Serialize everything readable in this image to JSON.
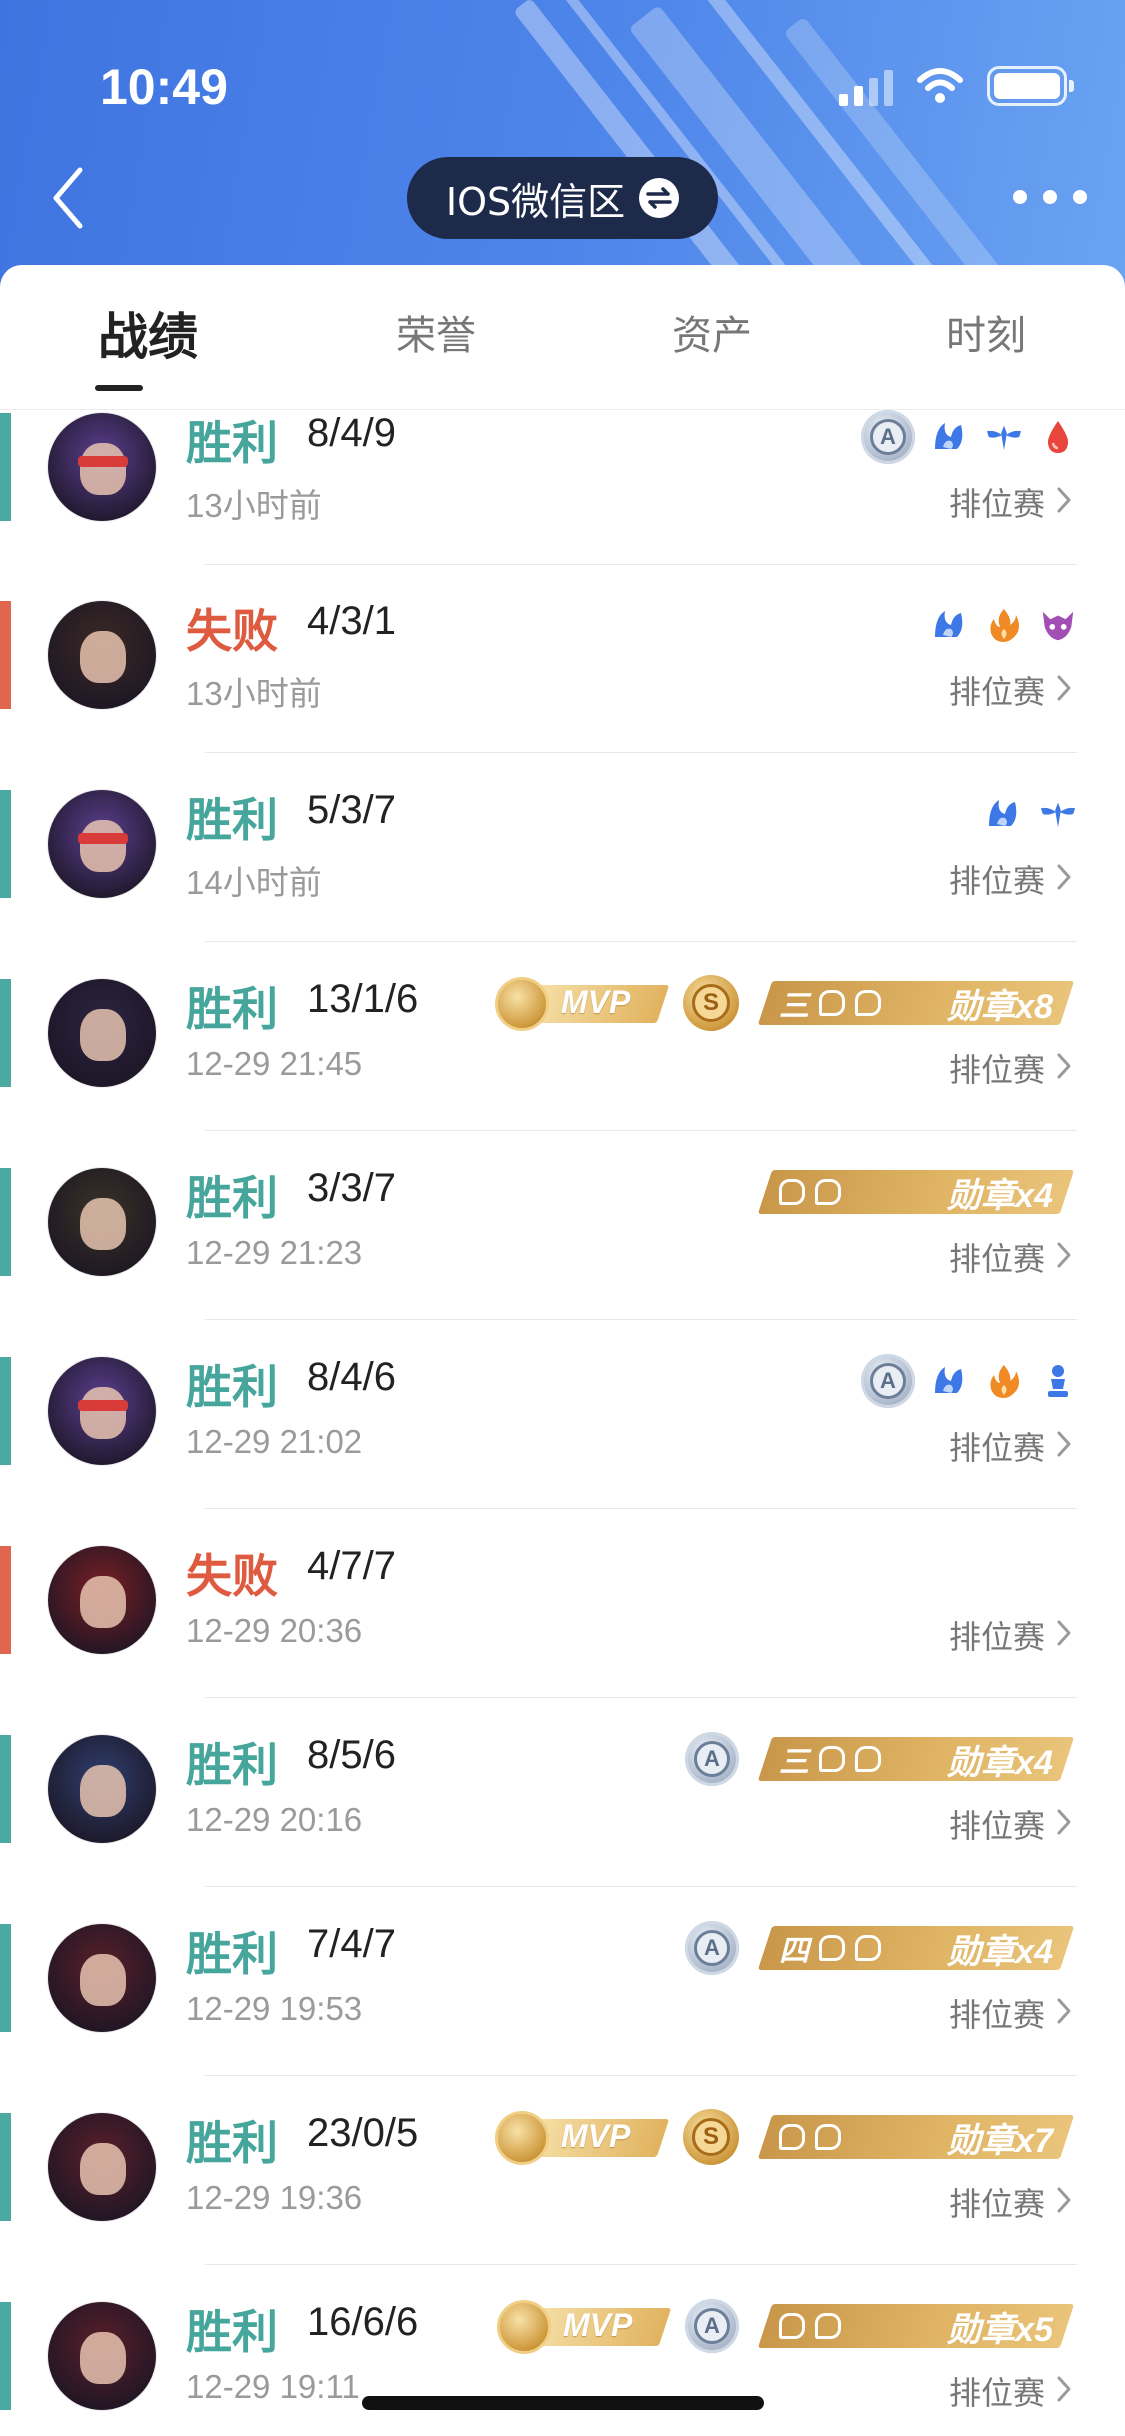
{
  "status_bar": {
    "time": "10:49"
  },
  "header": {
    "server_label": "IOS微信区"
  },
  "tabs": [
    {
      "label": "战绩",
      "active": true
    },
    {
      "label": "荣誉",
      "active": false
    },
    {
      "label": "资产",
      "active": false
    },
    {
      "label": "时刻",
      "active": false
    }
  ],
  "matches": [
    {
      "result": "胜利",
      "outcome": "win",
      "kda": "8/4/9",
      "time": "13小时前",
      "mode": "排位赛",
      "hero_color": "#5b3f8f",
      "badges": [
        "a",
        "icon-blue-flame",
        "icon-blue-wings",
        "icon-red-drop"
      ]
    },
    {
      "result": "失败",
      "outcome": "loss",
      "kda": "4/3/1",
      "time": "13小时前",
      "mode": "排位赛",
      "hero_color": "#3b2a25",
      "badges": [
        "icon-blue-flame",
        "icon-orange-fire",
        "icon-purple-demon"
      ]
    },
    {
      "result": "胜利",
      "outcome": "win",
      "kda": "5/3/7",
      "time": "14小时前",
      "mode": "排位赛",
      "hero_color": "#5b3f8f",
      "badges": [
        "icon-blue-flame",
        "icon-blue-wings"
      ]
    },
    {
      "result": "胜利",
      "outcome": "win",
      "kda": "13/1/6",
      "time": "12-29 21:45",
      "mode": "排位赛",
      "hero_color": "#2d2440",
      "badges": [
        "mvp",
        "s",
        "medal"
      ],
      "medal": {
        "prefix": "三",
        "label": "勋章x8"
      }
    },
    {
      "result": "胜利",
      "outcome": "win",
      "kda": "3/3/7",
      "time": "12-29 21:23",
      "mode": "排位赛",
      "hero_color": "#3a3326",
      "badges": [
        "medal"
      ],
      "medal": {
        "prefix": "",
        "label": "勋章x4"
      }
    },
    {
      "result": "胜利",
      "outcome": "win",
      "kda": "8/4/6",
      "time": "12-29 21:02",
      "mode": "排位赛",
      "hero_color": "#5b3f8f",
      "badges": [
        "a",
        "icon-blue-flame",
        "icon-orange-fire",
        "icon-blue-pawn"
      ]
    },
    {
      "result": "失败",
      "outcome": "loss",
      "kda": "4/7/7",
      "time": "12-29 20:36",
      "mode": "排位赛",
      "hero_color": "#7a1f24",
      "badges": []
    },
    {
      "result": "胜利",
      "outcome": "win",
      "kda": "8/5/6",
      "time": "12-29 20:16",
      "mode": "排位赛",
      "hero_color": "#2f3f6e",
      "badges": [
        "a",
        "medal"
      ],
      "medal": {
        "prefix": "三",
        "label": "勋章x4"
      }
    },
    {
      "result": "胜利",
      "outcome": "win",
      "kda": "7/4/7",
      "time": "12-29 19:53",
      "mode": "排位赛",
      "hero_color": "#5a1f2a",
      "badges": [
        "a",
        "medal"
      ],
      "medal": {
        "prefix": "四",
        "label": "勋章x4"
      }
    },
    {
      "result": "胜利",
      "outcome": "win",
      "kda": "23/0/5",
      "time": "12-29 19:36",
      "mode": "排位赛",
      "hero_color": "#5a1f2a",
      "badges": [
        "mvp",
        "s",
        "medal"
      ],
      "medal": {
        "prefix": "",
        "label": "勋章x7"
      }
    },
    {
      "result": "胜利",
      "outcome": "win",
      "kda": "16/6/6",
      "time": "12-29 19:11",
      "mode": "排位赛",
      "hero_color": "#5a1f2a",
      "badges": [
        "mvp",
        "a",
        "medal"
      ],
      "medal": {
        "prefix": "",
        "label": "勋章x5"
      }
    }
  ],
  "badge_text": {
    "mvp": "MVP",
    "a": "A",
    "s": "S"
  },
  "colors": {
    "header": "#4a80e8",
    "win": "#47a69c",
    "loss": "#df5b40",
    "pill": "#1d2a4a"
  }
}
